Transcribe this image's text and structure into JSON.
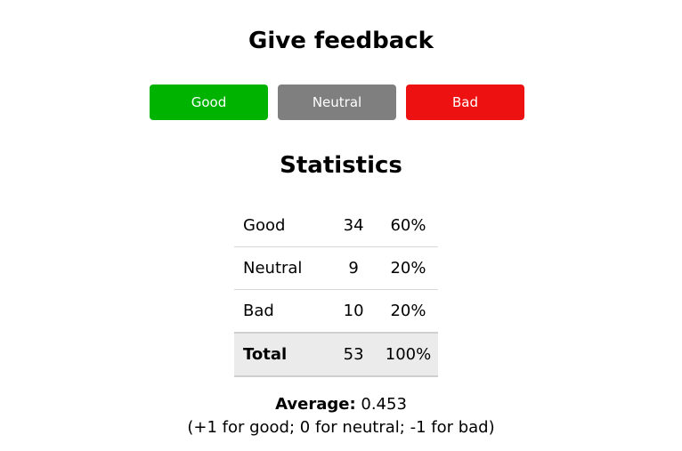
{
  "feedback": {
    "title": "Give feedback",
    "buttons": {
      "good": "Good",
      "neutral": "Neutral",
      "bad": "Bad"
    },
    "colors": {
      "good": "#00b300",
      "neutral": "#7f7f7f",
      "bad": "#ee1111"
    }
  },
  "statistics": {
    "title": "Statistics",
    "rows": [
      {
        "label": "Good",
        "count": "34",
        "percent": "60%"
      },
      {
        "label": "Neutral",
        "count": "9",
        "percent": "20%"
      },
      {
        "label": "Bad",
        "count": "10",
        "percent": "20%"
      }
    ],
    "total": {
      "label": "Total",
      "count": "53",
      "percent": "100%"
    },
    "average": {
      "label": "Average:",
      "value": "0.453",
      "note": "(+1 for good; 0 for neutral; -1 for bad)"
    }
  }
}
